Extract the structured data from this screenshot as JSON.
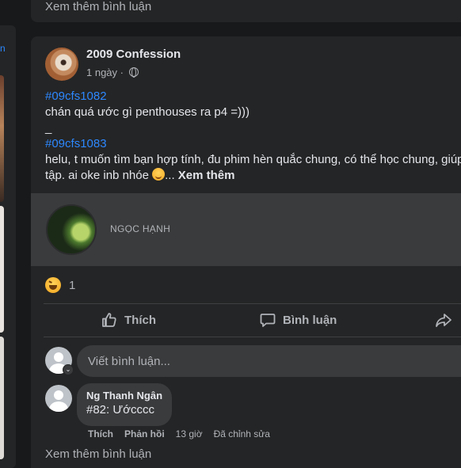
{
  "previous_post": {
    "see_more_comments": "Xem thêm bình luận"
  },
  "post": {
    "page_name": "2009 Confession",
    "time": "1 ngày",
    "meta_sep": " · ",
    "lines": [
      {
        "type": "hashtag",
        "text": "#09cfs1082"
      },
      {
        "type": "text",
        "text": "chán quá ước gì penthouses ra p4 =)))"
      },
      {
        "type": "text",
        "text": "_"
      },
      {
        "type": "hashtag",
        "text": "#09cfs1083"
      },
      {
        "type": "text",
        "text": "helu, t muốn tìm bạn hợp tính, đu phim hèn quắc chung, có thể học chung, giúp"
      }
    ],
    "last_line_text": "tập. ai oke inb nhóe ",
    "ellipsis": "... ",
    "see_more": "Xem thêm",
    "attachment_name": "NGỌC HẠNH",
    "reaction_count": "1",
    "actions": {
      "like": "Thích",
      "comment": "Bình luận"
    }
  },
  "composer": {
    "placeholder": "Viết bình luận..."
  },
  "comment": {
    "author": "Ng Thanh Ngân",
    "text": "#82: Ướcccc",
    "like": "Thích",
    "reply": "Phản hồi",
    "time": "13 giờ",
    "edited": "Đã chỉnh sửa"
  },
  "see_more_comments": "Xem thêm bình luận",
  "colors": {
    "background": "#18191a",
    "card": "#242526",
    "link": "#2d88ff",
    "secondary_text": "#b0b3b8"
  }
}
